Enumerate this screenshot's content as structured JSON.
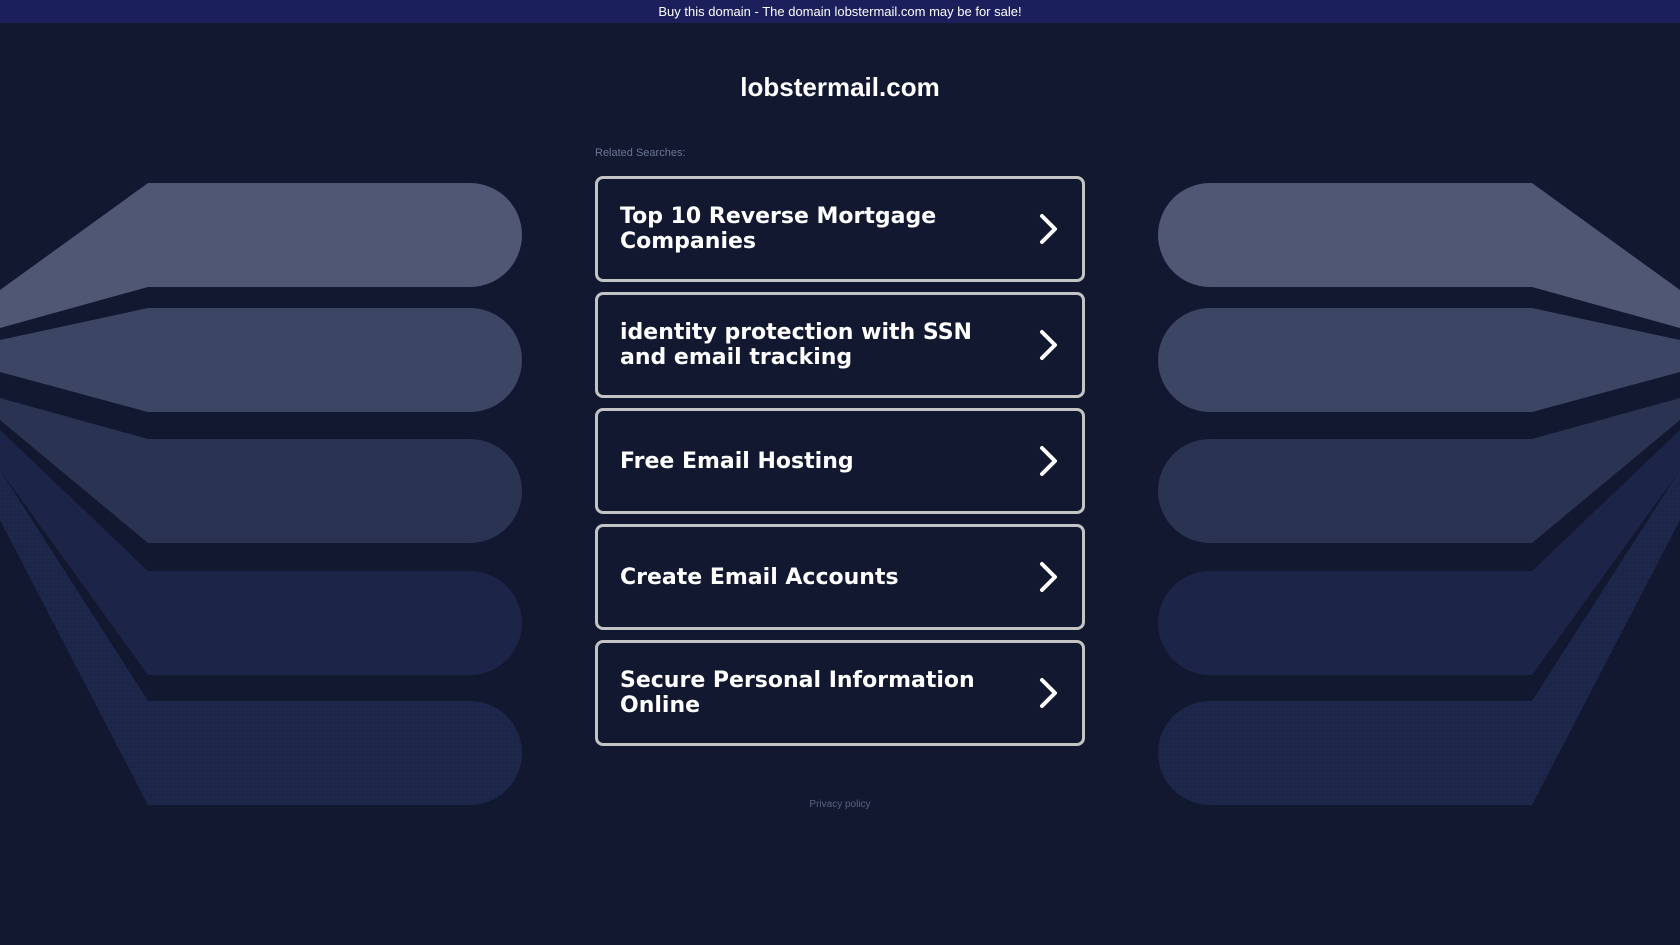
{
  "banner": {
    "text": "Buy this domain - The domain lobstermail.com may be for sale!"
  },
  "domain": {
    "name": "lobstermail.com"
  },
  "related": {
    "label": "Related Searches:",
    "items": [
      {
        "label": "Top 10 Reverse Mortgage Companies"
      },
      {
        "label": "identity protection with SSN and email tracking"
      },
      {
        "label": "Free Email Hosting"
      },
      {
        "label": "Create Email Accounts"
      },
      {
        "label": "Secure Personal Information Online"
      }
    ]
  },
  "footer": {
    "privacy_label": "Privacy policy"
  },
  "colors": {
    "background": "#111830",
    "banner": "#1b1f5c",
    "card_border": "#c4c4c4",
    "text": "#ffffff"
  }
}
